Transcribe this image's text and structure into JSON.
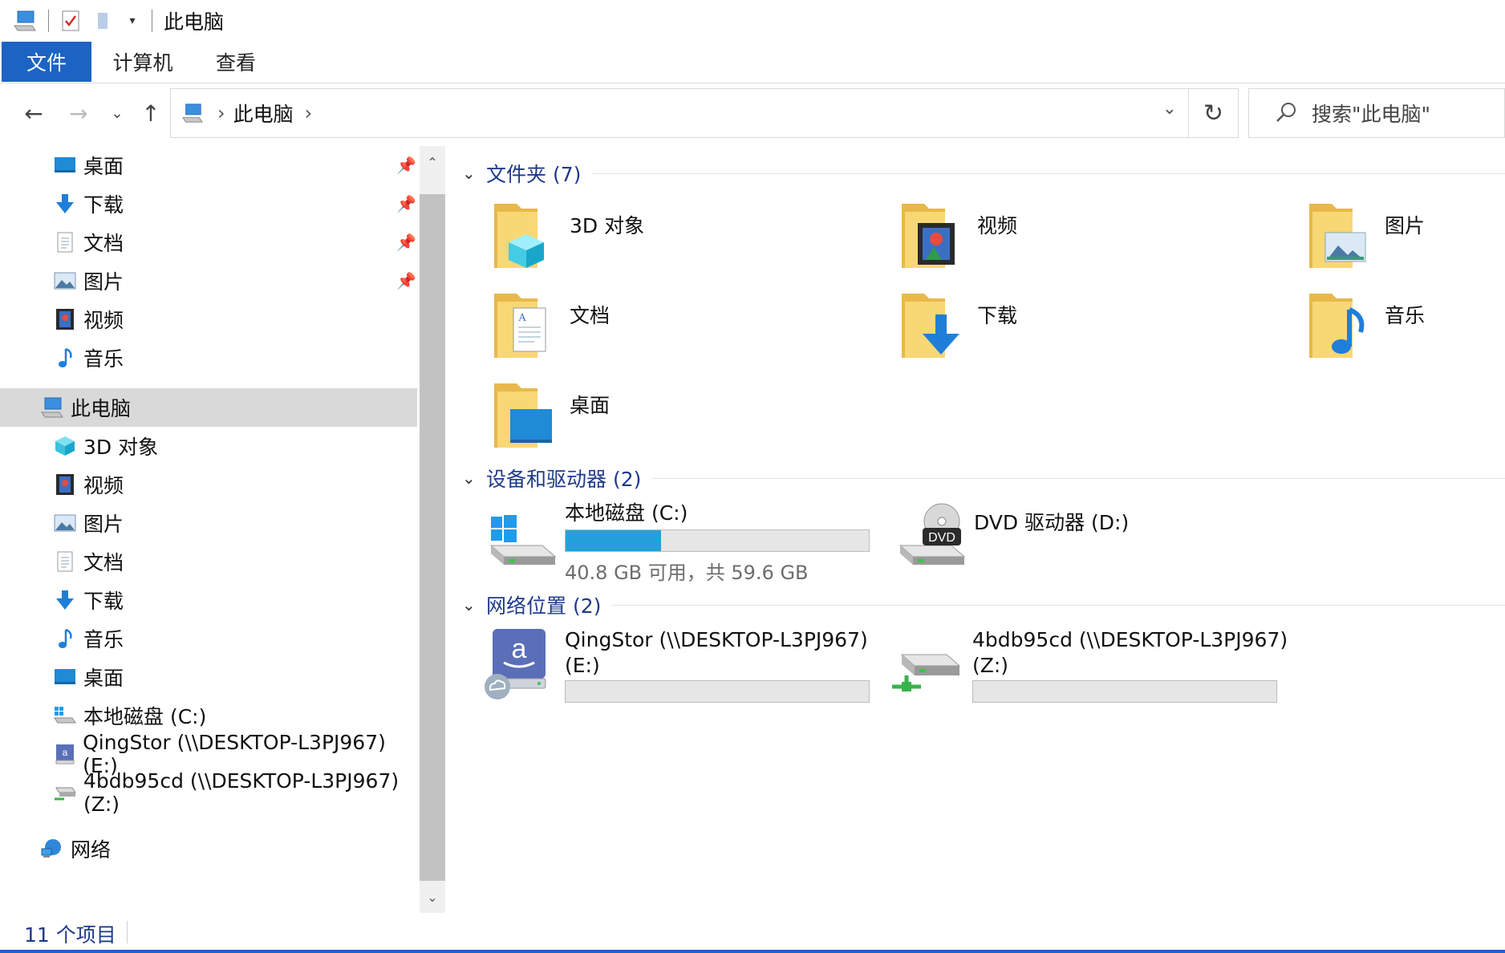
{
  "window": {
    "title": "此电脑"
  },
  "ribbon": {
    "tabs": [
      "文件",
      "计算机",
      "查看"
    ]
  },
  "address": {
    "crumb": "此电脑",
    "search_placeholder": "搜索\"此电脑\""
  },
  "nav": {
    "quick_access": [
      {
        "label": "桌面",
        "icon": "desktop-icon",
        "pinned": true
      },
      {
        "label": "下载",
        "icon": "download-icon",
        "pinned": true
      },
      {
        "label": "文档",
        "icon": "document-icon",
        "pinned": true
      },
      {
        "label": "图片",
        "icon": "picture-icon",
        "pinned": true
      },
      {
        "label": "视频",
        "icon": "video-icon",
        "pinned": false
      },
      {
        "label": "音乐",
        "icon": "music-icon",
        "pinned": false
      }
    ],
    "this_pc": "此电脑",
    "pc_items": [
      {
        "label": "3D 对象",
        "icon": "cube-icon"
      },
      {
        "label": "视频",
        "icon": "video-icon"
      },
      {
        "label": "图片",
        "icon": "picture-icon"
      },
      {
        "label": "文档",
        "icon": "document-icon"
      },
      {
        "label": "下载",
        "icon": "download-icon"
      },
      {
        "label": "音乐",
        "icon": "music-icon"
      },
      {
        "label": "桌面",
        "icon": "desktop-icon"
      },
      {
        "label": "本地磁盘 (C:)",
        "icon": "windows-drive-icon"
      },
      {
        "label": "QingStor (\\\\DESKTOP-L3PJ967) (E:)",
        "icon": "network-share-icon"
      },
      {
        "label": "4bdb95cd (\\\\DESKTOP-L3PJ967) (Z:)",
        "icon": "network-drive-icon"
      }
    ],
    "network": "网络"
  },
  "content": {
    "groups": {
      "folders": "文件夹 (7)",
      "devices": "设备和驱动器 (2)",
      "network": "网络位置 (2)"
    },
    "folders": [
      {
        "label": "3D 对象",
        "icon": "folder-3d-icon"
      },
      {
        "label": "视频",
        "icon": "folder-video-icon"
      },
      {
        "label": "图片",
        "icon": "folder-picture-icon"
      },
      {
        "label": "文档",
        "icon": "folder-document-icon"
      },
      {
        "label": "下载",
        "icon": "folder-download-icon"
      },
      {
        "label": "音乐",
        "icon": "folder-music-icon"
      },
      {
        "label": "桌面",
        "icon": "folder-desktop-icon"
      }
    ],
    "drives": [
      {
        "label": "本地磁盘 (C:)",
        "info": "40.8 GB 可用，共 59.6 GB",
        "used_fraction": 0.315,
        "icon": "windows-drive-icon"
      },
      {
        "label": "DVD 驱动器 (D:)",
        "icon": "dvd-drive-icon",
        "badge": "DVD"
      }
    ],
    "network_locations": [
      {
        "line1": "QingStor (\\\\DESKTOP-L3PJ967)",
        "line2": "(E:)",
        "icon": "amazon-cloud-drive-icon"
      },
      {
        "line1": "4bdb95cd (\\\\DESKTOP-L3PJ967)",
        "line2": "(Z:)",
        "icon": "network-drive-icon"
      }
    ]
  },
  "status": {
    "count": "11 个项目"
  },
  "colors": {
    "accent": "#1b64c4",
    "group_title": "#1e3a8a",
    "bar_fill": "#26a0da",
    "folder": "#f8d775"
  }
}
